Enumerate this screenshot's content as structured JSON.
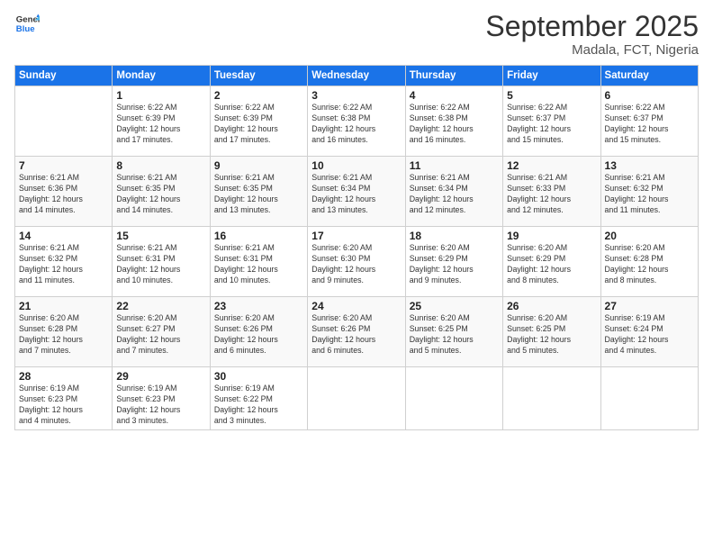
{
  "header": {
    "logo_line1": "General",
    "logo_line2": "Blue",
    "title": "September 2025",
    "subtitle": "Madala, FCT, Nigeria"
  },
  "weekdays": [
    "Sunday",
    "Monday",
    "Tuesday",
    "Wednesday",
    "Thursday",
    "Friday",
    "Saturday"
  ],
  "weeks": [
    [
      {
        "day": "",
        "info": ""
      },
      {
        "day": "1",
        "info": "Sunrise: 6:22 AM\nSunset: 6:39 PM\nDaylight: 12 hours\nand 17 minutes."
      },
      {
        "day": "2",
        "info": "Sunrise: 6:22 AM\nSunset: 6:39 PM\nDaylight: 12 hours\nand 17 minutes."
      },
      {
        "day": "3",
        "info": "Sunrise: 6:22 AM\nSunset: 6:38 PM\nDaylight: 12 hours\nand 16 minutes."
      },
      {
        "day": "4",
        "info": "Sunrise: 6:22 AM\nSunset: 6:38 PM\nDaylight: 12 hours\nand 16 minutes."
      },
      {
        "day": "5",
        "info": "Sunrise: 6:22 AM\nSunset: 6:37 PM\nDaylight: 12 hours\nand 15 minutes."
      },
      {
        "day": "6",
        "info": "Sunrise: 6:22 AM\nSunset: 6:37 PM\nDaylight: 12 hours\nand 15 minutes."
      }
    ],
    [
      {
        "day": "7",
        "info": "Sunrise: 6:21 AM\nSunset: 6:36 PM\nDaylight: 12 hours\nand 14 minutes."
      },
      {
        "day": "8",
        "info": "Sunrise: 6:21 AM\nSunset: 6:35 PM\nDaylight: 12 hours\nand 14 minutes."
      },
      {
        "day": "9",
        "info": "Sunrise: 6:21 AM\nSunset: 6:35 PM\nDaylight: 12 hours\nand 13 minutes."
      },
      {
        "day": "10",
        "info": "Sunrise: 6:21 AM\nSunset: 6:34 PM\nDaylight: 12 hours\nand 13 minutes."
      },
      {
        "day": "11",
        "info": "Sunrise: 6:21 AM\nSunset: 6:34 PM\nDaylight: 12 hours\nand 12 minutes."
      },
      {
        "day": "12",
        "info": "Sunrise: 6:21 AM\nSunset: 6:33 PM\nDaylight: 12 hours\nand 12 minutes."
      },
      {
        "day": "13",
        "info": "Sunrise: 6:21 AM\nSunset: 6:32 PM\nDaylight: 12 hours\nand 11 minutes."
      }
    ],
    [
      {
        "day": "14",
        "info": "Sunrise: 6:21 AM\nSunset: 6:32 PM\nDaylight: 12 hours\nand 11 minutes."
      },
      {
        "day": "15",
        "info": "Sunrise: 6:21 AM\nSunset: 6:31 PM\nDaylight: 12 hours\nand 10 minutes."
      },
      {
        "day": "16",
        "info": "Sunrise: 6:21 AM\nSunset: 6:31 PM\nDaylight: 12 hours\nand 10 minutes."
      },
      {
        "day": "17",
        "info": "Sunrise: 6:20 AM\nSunset: 6:30 PM\nDaylight: 12 hours\nand 9 minutes."
      },
      {
        "day": "18",
        "info": "Sunrise: 6:20 AM\nSunset: 6:29 PM\nDaylight: 12 hours\nand 9 minutes."
      },
      {
        "day": "19",
        "info": "Sunrise: 6:20 AM\nSunset: 6:29 PM\nDaylight: 12 hours\nand 8 minutes."
      },
      {
        "day": "20",
        "info": "Sunrise: 6:20 AM\nSunset: 6:28 PM\nDaylight: 12 hours\nand 8 minutes."
      }
    ],
    [
      {
        "day": "21",
        "info": "Sunrise: 6:20 AM\nSunset: 6:28 PM\nDaylight: 12 hours\nand 7 minutes."
      },
      {
        "day": "22",
        "info": "Sunrise: 6:20 AM\nSunset: 6:27 PM\nDaylight: 12 hours\nand 7 minutes."
      },
      {
        "day": "23",
        "info": "Sunrise: 6:20 AM\nSunset: 6:26 PM\nDaylight: 12 hours\nand 6 minutes."
      },
      {
        "day": "24",
        "info": "Sunrise: 6:20 AM\nSunset: 6:26 PM\nDaylight: 12 hours\nand 6 minutes."
      },
      {
        "day": "25",
        "info": "Sunrise: 6:20 AM\nSunset: 6:25 PM\nDaylight: 12 hours\nand 5 minutes."
      },
      {
        "day": "26",
        "info": "Sunrise: 6:20 AM\nSunset: 6:25 PM\nDaylight: 12 hours\nand 5 minutes."
      },
      {
        "day": "27",
        "info": "Sunrise: 6:19 AM\nSunset: 6:24 PM\nDaylight: 12 hours\nand 4 minutes."
      }
    ],
    [
      {
        "day": "28",
        "info": "Sunrise: 6:19 AM\nSunset: 6:23 PM\nDaylight: 12 hours\nand 4 minutes."
      },
      {
        "day": "29",
        "info": "Sunrise: 6:19 AM\nSunset: 6:23 PM\nDaylight: 12 hours\nand 3 minutes."
      },
      {
        "day": "30",
        "info": "Sunrise: 6:19 AM\nSunset: 6:22 PM\nDaylight: 12 hours\nand 3 minutes."
      },
      {
        "day": "",
        "info": ""
      },
      {
        "day": "",
        "info": ""
      },
      {
        "day": "",
        "info": ""
      },
      {
        "day": "",
        "info": ""
      }
    ]
  ]
}
